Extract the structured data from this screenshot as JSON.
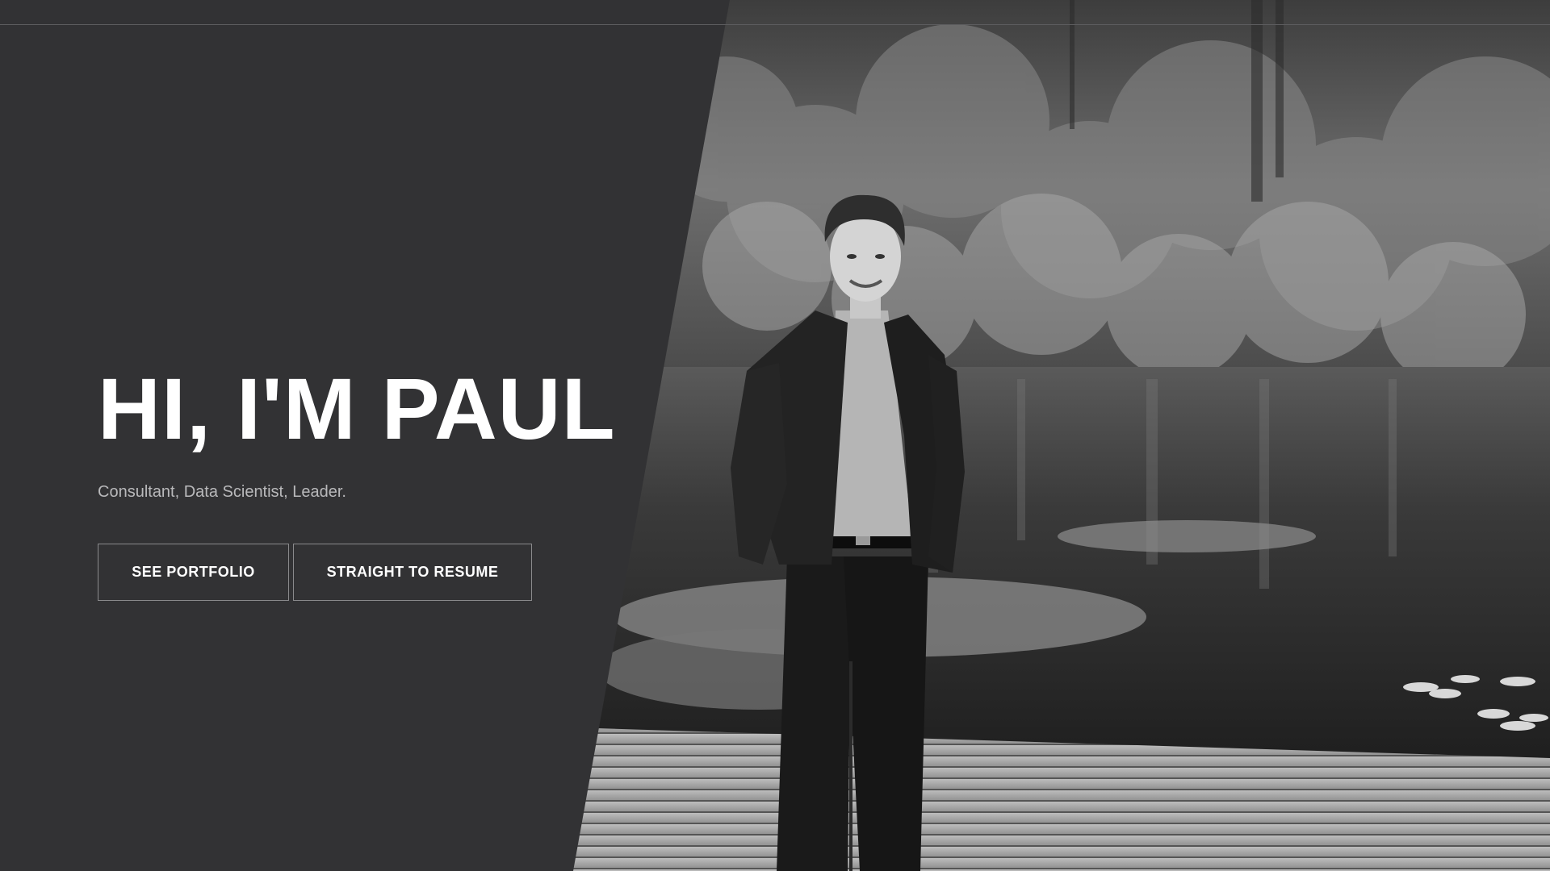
{
  "hero": {
    "headline": "HI, I'M PAUL",
    "tagline": "Consultant, Data Scientist, Leader.",
    "buttons": {
      "portfolio": "SEE PORTFOLIO",
      "resume": "STRAIGHT TO RESUME"
    }
  },
  "colors": {
    "panel_background": "#323234",
    "headline": "#ffffff",
    "tagline": "#b9b9bb",
    "button_border": "#8a8a8c"
  },
  "photo": {
    "subject": "man in dark suit standing on wooden dock by forest lake",
    "style": "black-and-white"
  }
}
